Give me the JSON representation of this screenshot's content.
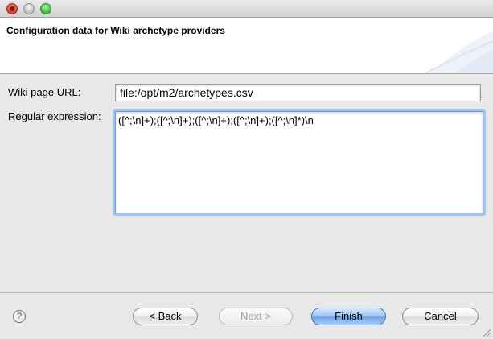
{
  "window": {
    "controls": [
      "close",
      "minimize",
      "zoom"
    ]
  },
  "header": {
    "title": "Configuration data for Wiki archetype providers"
  },
  "form": {
    "url_label": "Wiki page URL:",
    "url_value": "file:/opt/m2/archetypes.csv",
    "regex_label": "Regular expression:",
    "regex_value": "([^;\\n]+);([^;\\n]+);([^;\\n]+);([^;\\n]+);([^;\\n]*)\\n"
  },
  "footer": {
    "help_glyph": "?",
    "back_label": "< Back",
    "next_label": "Next >",
    "finish_label": "Finish",
    "cancel_label": "Cancel"
  },
  "colors": {
    "focus_ring": "#a3c3ef",
    "default_button": "#6fa4e6",
    "close_button": "#d63a2b",
    "zoom_button": "#3eb33a"
  }
}
